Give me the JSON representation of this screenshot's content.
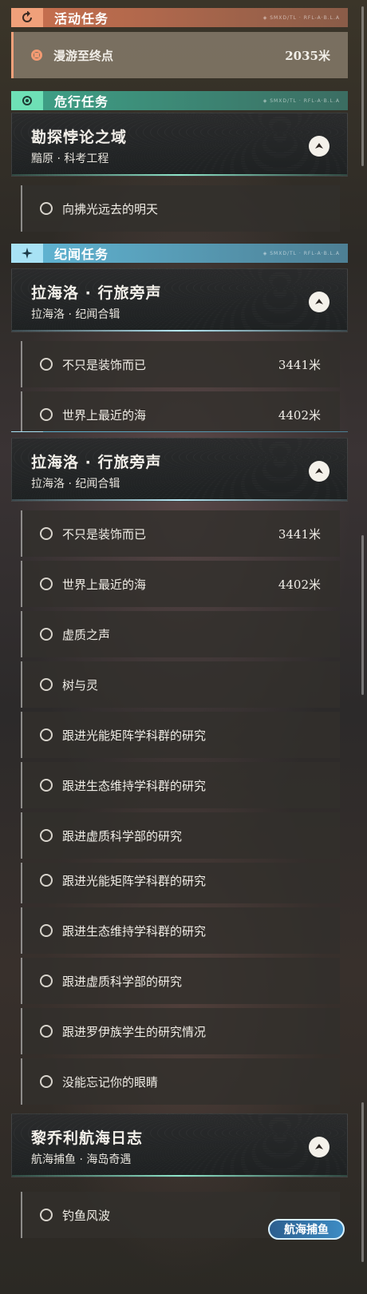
{
  "sections": {
    "active": {
      "title": "活动任务",
      "icon": "quest-refresh-icon"
    },
    "danger": {
      "title": "危行任务",
      "icon": "gear-flower-icon"
    },
    "lore": {
      "title": "纪闻任务",
      "icon": "sparkle-icon"
    },
    "header_deco": "◈ SMXD/TL · RFL-A·B.L.A"
  },
  "active_quest": {
    "label": "漫游至终点",
    "distance": "2035米"
  },
  "danger_quest": {
    "title": "勘探悖论之域",
    "subtitle": "黯原 · 科考工程",
    "steps": [
      {
        "label": "向拂光远去的明天"
      }
    ]
  },
  "lore_quest": {
    "title": "拉海洛 · 行旅旁声",
    "subtitle": "拉海洛 · 纪闻合辑",
    "steps": [
      {
        "label": "不只是装饰而已",
        "distance": "3441米"
      },
      {
        "label": "世界上最近的海",
        "distance": "4402米"
      },
      {
        "label": "虚质之声",
        "distance": ""
      },
      {
        "label": "树与灵",
        "distance": ""
      },
      {
        "label": "跟进光能矩阵学科群的研究",
        "distance": ""
      },
      {
        "label": "跟进生态维持学科群的研究",
        "distance": ""
      },
      {
        "label": "跟进虚质科学部的研究",
        "distance": ""
      },
      {
        "label": "跟进罗伊族学生的研究情况",
        "distance": ""
      },
      {
        "label": "没能忘记你的眼睛",
        "distance": ""
      }
    ]
  },
  "fishing_quest": {
    "title": "黎乔利航海日志",
    "subtitle": "航海捕鱼 · 海岛奇遇",
    "steps": [
      {
        "label": "钓鱼风波"
      }
    ],
    "badge": "航海捕鱼"
  },
  "colors": {
    "active_accent": "#f0a07a",
    "danger_accent": "#6ee0b6",
    "lore_accent": "#a8e2f5"
  }
}
